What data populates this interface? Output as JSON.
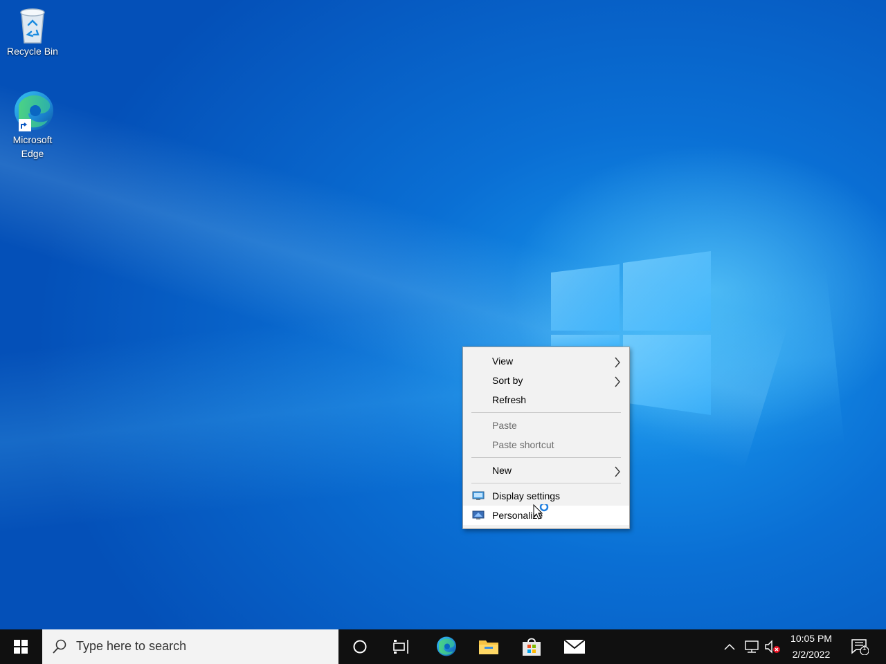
{
  "desktop": {
    "icons": [
      {
        "label": "Recycle Bin",
        "icon": "recycle-bin-icon"
      },
      {
        "label": "Microsoft\nEdge",
        "line1": "Microsoft",
        "line2": "Edge",
        "icon": "edge-icon"
      }
    ]
  },
  "context_menu": {
    "items": [
      {
        "label": "View",
        "submenu": true,
        "enabled": true
      },
      {
        "label": "Sort by",
        "submenu": true,
        "enabled": true
      },
      {
        "label": "Refresh",
        "submenu": false,
        "enabled": true
      },
      {
        "label": "Paste",
        "submenu": false,
        "enabled": false
      },
      {
        "label": "Paste shortcut",
        "submenu": false,
        "enabled": false
      },
      {
        "label": "New",
        "submenu": true,
        "enabled": true
      },
      {
        "label": "Display settings",
        "submenu": false,
        "enabled": true,
        "icon": "display-settings-icon"
      },
      {
        "label": "Personalize",
        "submenu": false,
        "enabled": true,
        "icon": "personalize-icon",
        "hovered": true
      }
    ]
  },
  "taskbar": {
    "search_placeholder": "Type here to search",
    "pinned": [
      "cortana-icon",
      "task-view-icon",
      "edge-icon",
      "file-explorer-icon",
      "microsoft-store-icon",
      "mail-icon"
    ],
    "tray": {
      "time": "10:05 PM",
      "date": "2/2/2022",
      "notification_count": "1"
    }
  },
  "colors": {
    "taskbar": "#101010",
    "desktop_accent": "#0a6fd4",
    "menu_bg": "#f2f2f2"
  }
}
